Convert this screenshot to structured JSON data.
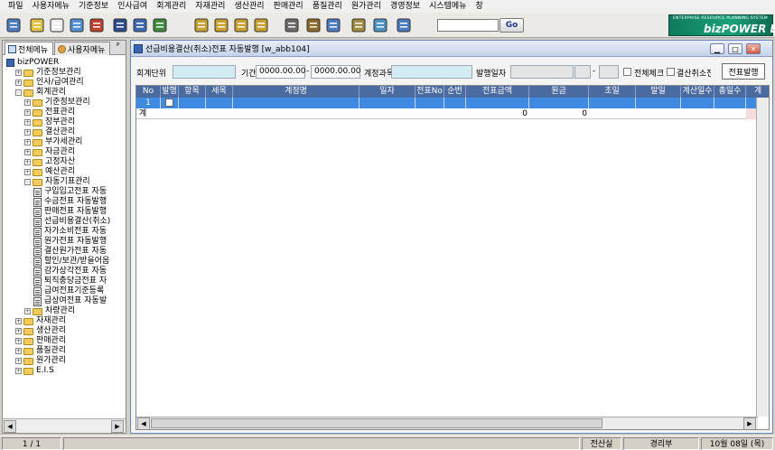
{
  "menu": [
    "파일",
    "사용자메뉴",
    "기준정보",
    "인사급여",
    "회계관리",
    "자재관리",
    "생산관리",
    "판매관리",
    "품질관리",
    "원가관리",
    "경영정보",
    "시스템메뉴",
    "창"
  ],
  "toolbar": {
    "icons": [
      "exit-icon",
      "new-icon",
      "new-doc-icon",
      "save-icon",
      "delete-icon",
      "print-icon",
      "print-preview-icon",
      "excel-icon",
      "first-record-icon",
      "prev-record-icon",
      "next-record-icon",
      "last-record-icon",
      "calculator-icon",
      "settings-icon",
      "find-icon",
      "edit-icon",
      "refresh-icon",
      "export-icon"
    ],
    "search_value": "",
    "go_label": "Go"
  },
  "logo": {
    "tagline": "ENTERPRISE RESOURCE PLANNING SYSTEM",
    "name": "bizPOWER ERP"
  },
  "left_panel": {
    "tabs": [
      "전체메뉴",
      "사용자메뉴"
    ],
    "pin": "ᴾ",
    "tree": [
      {
        "label": "bizPOWER",
        "level": 0,
        "type": "root"
      },
      {
        "label": "기준정보관리",
        "level": 1,
        "type": "folder",
        "state": "+"
      },
      {
        "label": "인사/급여관리",
        "level": 1,
        "type": "folder",
        "state": "+"
      },
      {
        "label": "회계관리",
        "level": 1,
        "type": "folder",
        "state": "-"
      },
      {
        "label": "기준정보관리",
        "level": 2,
        "type": "folder",
        "state": "+"
      },
      {
        "label": "전표관리",
        "level": 2,
        "type": "folder",
        "state": "+"
      },
      {
        "label": "장부관리",
        "level": 2,
        "type": "folder",
        "state": "+"
      },
      {
        "label": "결산관리",
        "level": 2,
        "type": "folder",
        "state": "+"
      },
      {
        "label": "부가세관리",
        "level": 2,
        "type": "folder",
        "state": "+"
      },
      {
        "label": "자금관리",
        "level": 2,
        "type": "folder",
        "state": "+"
      },
      {
        "label": "고정자산",
        "level": 2,
        "type": "folder",
        "state": "+"
      },
      {
        "label": "예산관리",
        "level": 2,
        "type": "folder",
        "state": "+"
      },
      {
        "label": "자동기표관리",
        "level": 2,
        "type": "folder",
        "state": "-"
      },
      {
        "label": "구입입고전표 자동",
        "level": 3,
        "type": "doc"
      },
      {
        "label": "수금전표 자동발행",
        "level": 3,
        "type": "doc"
      },
      {
        "label": "판매전표 자동발행",
        "level": 3,
        "type": "doc"
      },
      {
        "label": "선급비용결산(취소)",
        "level": 3,
        "type": "doc",
        "selected": true
      },
      {
        "label": "자가소비전표 자동",
        "level": 3,
        "type": "doc"
      },
      {
        "label": "원가전표 자동발행",
        "level": 3,
        "type": "doc"
      },
      {
        "label": "결산원가전표 자동",
        "level": 3,
        "type": "doc"
      },
      {
        "label": "할인/보관/받을어음",
        "level": 3,
        "type": "doc"
      },
      {
        "label": "감가상각전표 자동",
        "level": 3,
        "type": "doc"
      },
      {
        "label": "퇴직충당금전표 자",
        "level": 3,
        "type": "doc"
      },
      {
        "label": "급여전표기준등록",
        "level": 3,
        "type": "doc"
      },
      {
        "label": "급상여전표 자동발",
        "level": 3,
        "type": "doc"
      },
      {
        "label": "차량관리",
        "level": 2,
        "type": "folder",
        "state": "+"
      },
      {
        "label": "자재관리",
        "level": 1,
        "type": "folder",
        "state": "+"
      },
      {
        "label": "생산관리",
        "level": 1,
        "type": "folder",
        "state": "+"
      },
      {
        "label": "판매관리",
        "level": 1,
        "type": "folder",
        "state": "+"
      },
      {
        "label": "품질관리",
        "level": 1,
        "type": "folder",
        "state": "+"
      },
      {
        "label": "원가관리",
        "level": 1,
        "type": "folder",
        "state": "+"
      },
      {
        "label": "E.I.S",
        "level": 1,
        "type": "folder",
        "state": "+"
      }
    ]
  },
  "window": {
    "title": "선급비용결산(취소)전표 자동발행 [w_abb104]",
    "filters": {
      "unit_label": "회계단위",
      "period_label": "기간",
      "period_from": "0000.00.00",
      "period_sep": "-",
      "period_to": "0000.00.00",
      "account_label": "계정과목",
      "issue_date_label": "발행일자",
      "issue_date_sep": "-",
      "check_all_label": "전체체크",
      "cancel_label": "결산취소전표",
      "issue_button": "전표발행"
    },
    "grid": {
      "columns": [
        "No",
        "발행",
        "항목",
        "세목",
        "계정명",
        "일자",
        "전표No",
        "순번",
        "전표금액",
        "원금",
        "초일",
        "말일",
        "계산일수",
        "총일수",
        "계"
      ],
      "rows": [
        {
          "no": "1",
          "checked": false
        }
      ],
      "total_row": {
        "label": "계",
        "amount": "0",
        "principal": "0"
      }
    }
  },
  "status": {
    "page": "1 / 1",
    "dept": "전산실",
    "user": "경리부",
    "date": "10월 08일 (목)"
  }
}
